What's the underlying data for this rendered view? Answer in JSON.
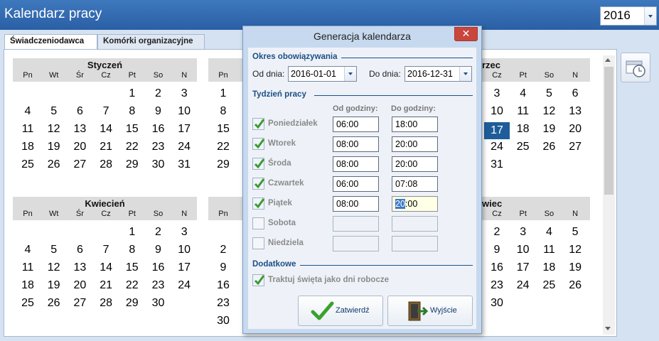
{
  "app": {
    "title": "Kalendarz pracy",
    "year": "2016"
  },
  "tabs": [
    {
      "label": "Świadczeniodawca"
    },
    {
      "label": "Komórki organizacyjne"
    }
  ],
  "weekdays": [
    "Pn",
    "Wt",
    "Śr",
    "Cz",
    "Pt",
    "So",
    "N"
  ],
  "months": {
    "jan": {
      "name": "Styczeń",
      "days": [
        [
          "",
          "",
          "",
          "",
          "1",
          "2",
          "3"
        ],
        [
          "4",
          "5",
          "6",
          "7",
          "8",
          "9",
          "10"
        ],
        [
          "11",
          "12",
          "13",
          "14",
          "15",
          "16",
          "17"
        ],
        [
          "18",
          "19",
          "20",
          "21",
          "22",
          "23",
          "24"
        ],
        [
          "25",
          "26",
          "27",
          "28",
          "29",
          "30",
          "31"
        ]
      ]
    },
    "feb": {
      "days": [
        [
          "1"
        ],
        [
          "8"
        ],
        [
          "15"
        ],
        [
          "22"
        ],
        [
          "29"
        ]
      ]
    },
    "mar": {
      "name_fragment": "rzec",
      "days": [
        [
          "3",
          "4",
          "5",
          "6"
        ],
        [
          "10",
          "11",
          "12",
          "13"
        ],
        [
          "17",
          "18",
          "19",
          "20"
        ],
        [
          "24",
          "25",
          "26",
          "27"
        ],
        [
          "31",
          "",
          "",
          ""
        ]
      ],
      "selected": "17"
    },
    "apr": {
      "name": "Kwiecień",
      "days": [
        [
          "",
          "",
          "",
          "",
          "1",
          "2",
          "3"
        ],
        [
          "4",
          "5",
          "6",
          "7",
          "8",
          "9",
          "10"
        ],
        [
          "11",
          "12",
          "13",
          "14",
          "15",
          "16",
          "17"
        ],
        [
          "18",
          "19",
          "20",
          "21",
          "22",
          "23",
          "24"
        ],
        [
          "25",
          "26",
          "27",
          "28",
          "29",
          "30",
          ""
        ]
      ]
    },
    "may": {
      "days": [
        [
          ""
        ],
        [
          "2"
        ],
        [
          "9"
        ],
        [
          "16"
        ],
        [
          "23"
        ],
        [
          "30"
        ]
      ]
    },
    "jun": {
      "name_fragment": "wiec",
      "days": [
        [
          "2",
          "3",
          "4",
          "5"
        ],
        [
          "9",
          "10",
          "11",
          "12"
        ],
        [
          "16",
          "17",
          "18",
          "19"
        ],
        [
          "23",
          "24",
          "25",
          "26"
        ],
        [
          "30",
          "",
          "",
          ""
        ]
      ]
    }
  },
  "dialog": {
    "title": "Generacja kalendarza",
    "close_glyph": "✕",
    "period_section": "Okres obowiązywania",
    "from_label": "Od dnia:",
    "from_value": "2016-01-01",
    "to_label": "Do dnia:",
    "to_value": "2016-12-31",
    "week_section": "Tydzień pracy",
    "col_from": "Od godziny:",
    "col_to": "Do godziny:",
    "days": [
      {
        "label": "Poniedziałek",
        "checked": true,
        "from": "06:00",
        "to": "18:00"
      },
      {
        "label": "Wtorek",
        "checked": true,
        "from": "08:00",
        "to": "20:00"
      },
      {
        "label": "Środa",
        "checked": true,
        "from": "08:00",
        "to": "20:00"
      },
      {
        "label": "Czwartek",
        "checked": true,
        "from": "06:00",
        "to": "07:08"
      },
      {
        "label": "Piątek",
        "checked": true,
        "from": "08:00",
        "to_sel": "20",
        "to_rest": ":00"
      },
      {
        "label": "Sobota",
        "checked": false,
        "from": "",
        "to": ""
      },
      {
        "label": "Niedziela",
        "checked": false,
        "from": "",
        "to": ""
      }
    ],
    "extra_section": "Dodatkowe",
    "holidays_label": "Traktuj święta jako dni robocze",
    "holidays_checked": true,
    "confirm_label": "Zatwierdź",
    "exit_label": "Wyjście"
  },
  "colors": {
    "titlebar": "#2f68ad",
    "selected_day": "#1f5d9a",
    "section": "#1c4f86",
    "check": "#3d9a2f"
  }
}
